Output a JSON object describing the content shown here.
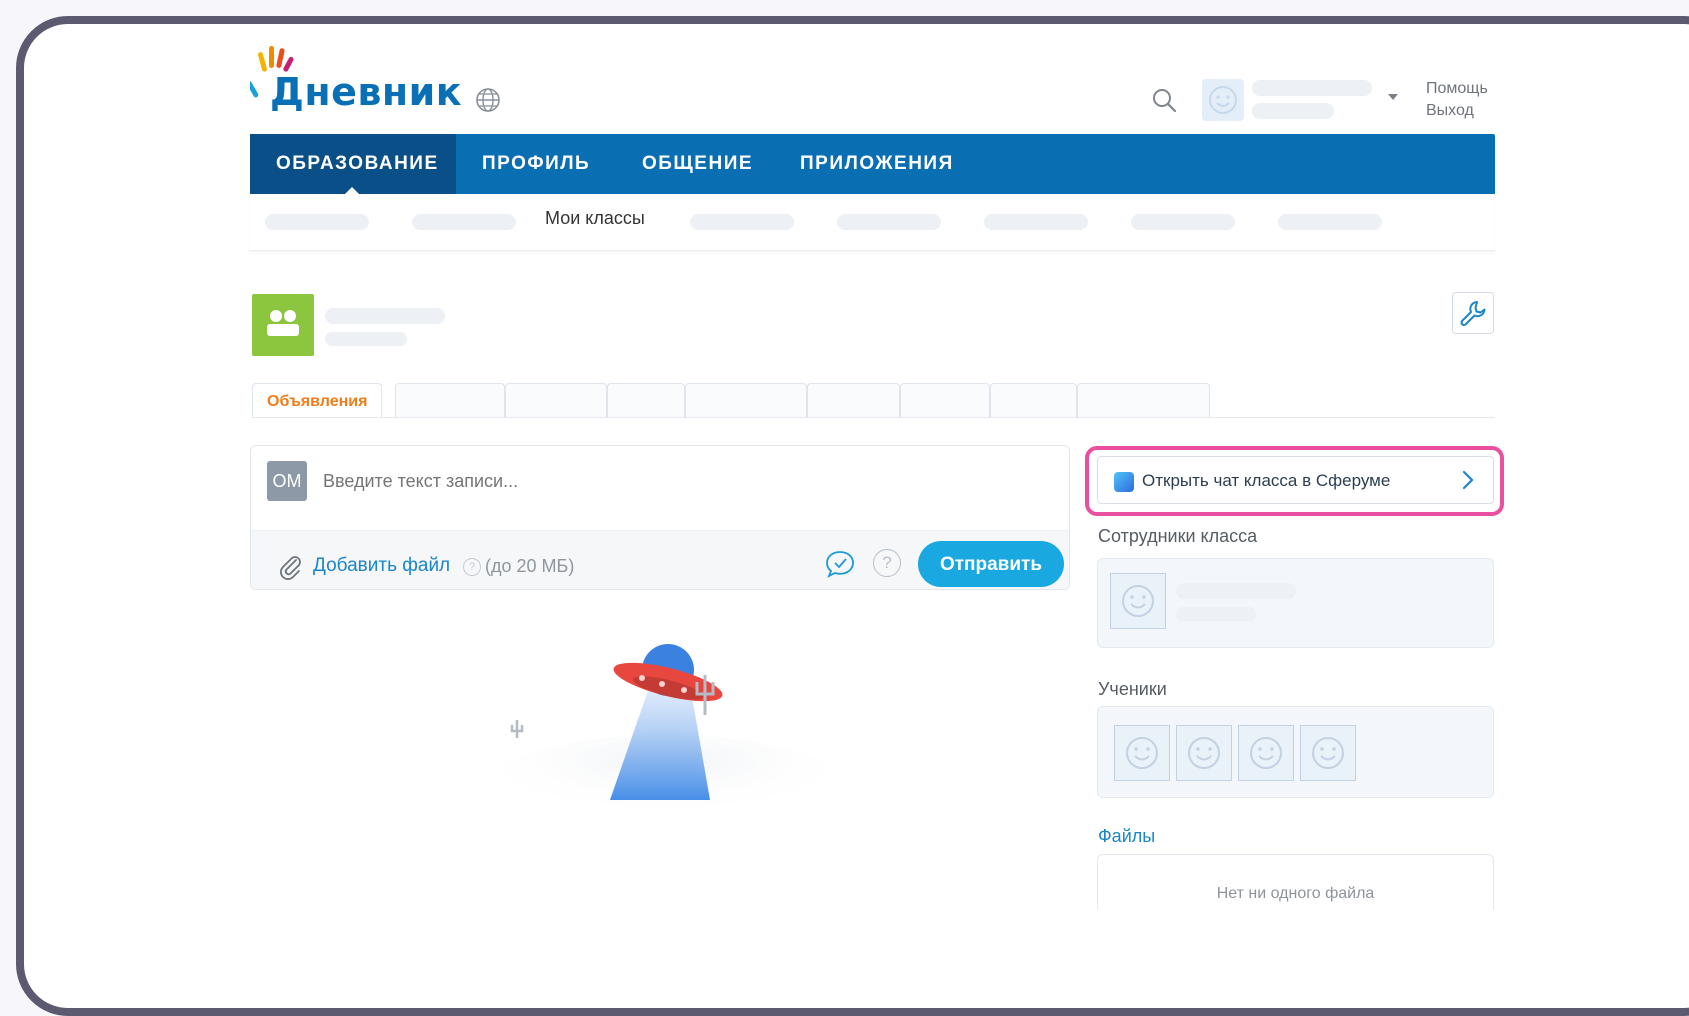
{
  "header": {
    "logo_text": "Дневник",
    "help_label": "Помощь",
    "exit_label": "Выход"
  },
  "nav": {
    "items": [
      {
        "label": "ОБРАЗОВАНИЕ",
        "active": true
      },
      {
        "label": "ПРОФИЛЬ",
        "active": false
      },
      {
        "label": "ОБЩЕНИЕ",
        "active": false
      },
      {
        "label": "ПРИЛОЖЕНИЯ",
        "active": false
      }
    ],
    "sub_active": "Мои классы"
  },
  "tabs": {
    "active_label": "Объявления"
  },
  "post": {
    "author_initials": "ОМ",
    "placeholder": "Введите текст записи...",
    "add_file_label": "Добавить файл",
    "file_limit": "(до 20 МБ)",
    "send_label": "Отправить"
  },
  "sidebar": {
    "sferum_label": "Открыть чат класса в Сферуме",
    "staff_title": "Сотрудники класса",
    "students_title": "Ученики",
    "files_title": "Файлы",
    "files_empty": "Нет ни одного файла"
  },
  "colors": {
    "nav_bg": "#0a6fb2",
    "nav_active": "#0a4f88",
    "send_button": "#19a8e0",
    "tab_active_text": "#f07d1a",
    "highlight": "#e8509f",
    "class_avatar": "#8cc63f"
  }
}
